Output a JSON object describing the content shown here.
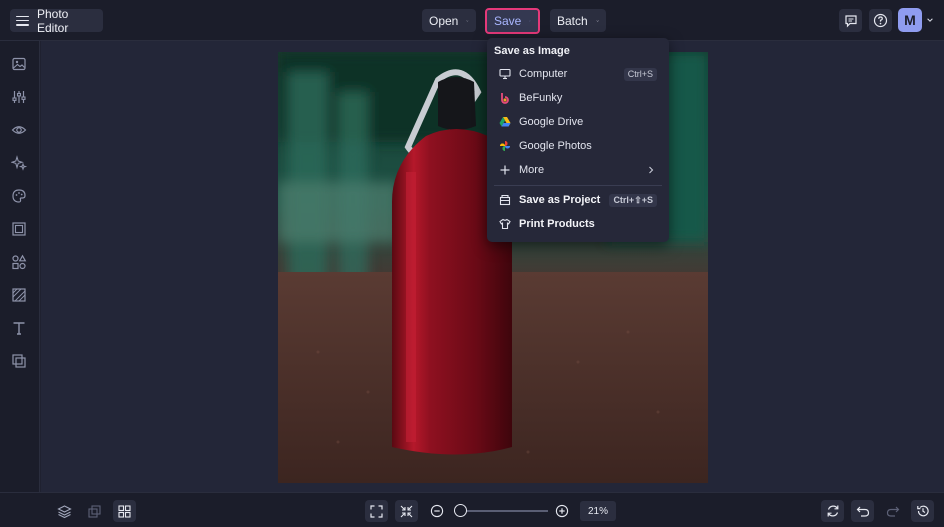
{
  "header": {
    "app_title": "Photo Editor",
    "menus": [
      {
        "label": "Open"
      },
      {
        "label": "Save"
      },
      {
        "label": "Batch"
      }
    ],
    "avatar_initial": "M"
  },
  "save_menu": {
    "header": "Save as Image",
    "items": [
      {
        "label": "Computer",
        "shortcut": "Ctrl+S",
        "icon": "monitor-icon"
      },
      {
        "label": "BeFunky",
        "icon": "befunky-logo-icon"
      },
      {
        "label": "Google Drive",
        "icon": "google-drive-icon"
      },
      {
        "label": "Google Photos",
        "icon": "google-photos-icon"
      },
      {
        "label": "More",
        "icon": "plus-icon"
      }
    ],
    "project": {
      "label": "Save as Project",
      "shortcut": "Ctrl+⇧+S"
    },
    "print": {
      "label": "Print Products"
    }
  },
  "sidebar_icons": [
    "image-icon",
    "adjustments-icon",
    "eye-icon",
    "sparkle-icon",
    "palette-icon",
    "frame-icon",
    "shapes-icon",
    "texture-icon",
    "text-icon",
    "overlay-icon"
  ],
  "zoom": {
    "value_label": "21%",
    "level": 0.21
  },
  "colors": {
    "accent": "#8f9cf0",
    "highlight_border": "#e5397a",
    "background": "#1f2130"
  }
}
